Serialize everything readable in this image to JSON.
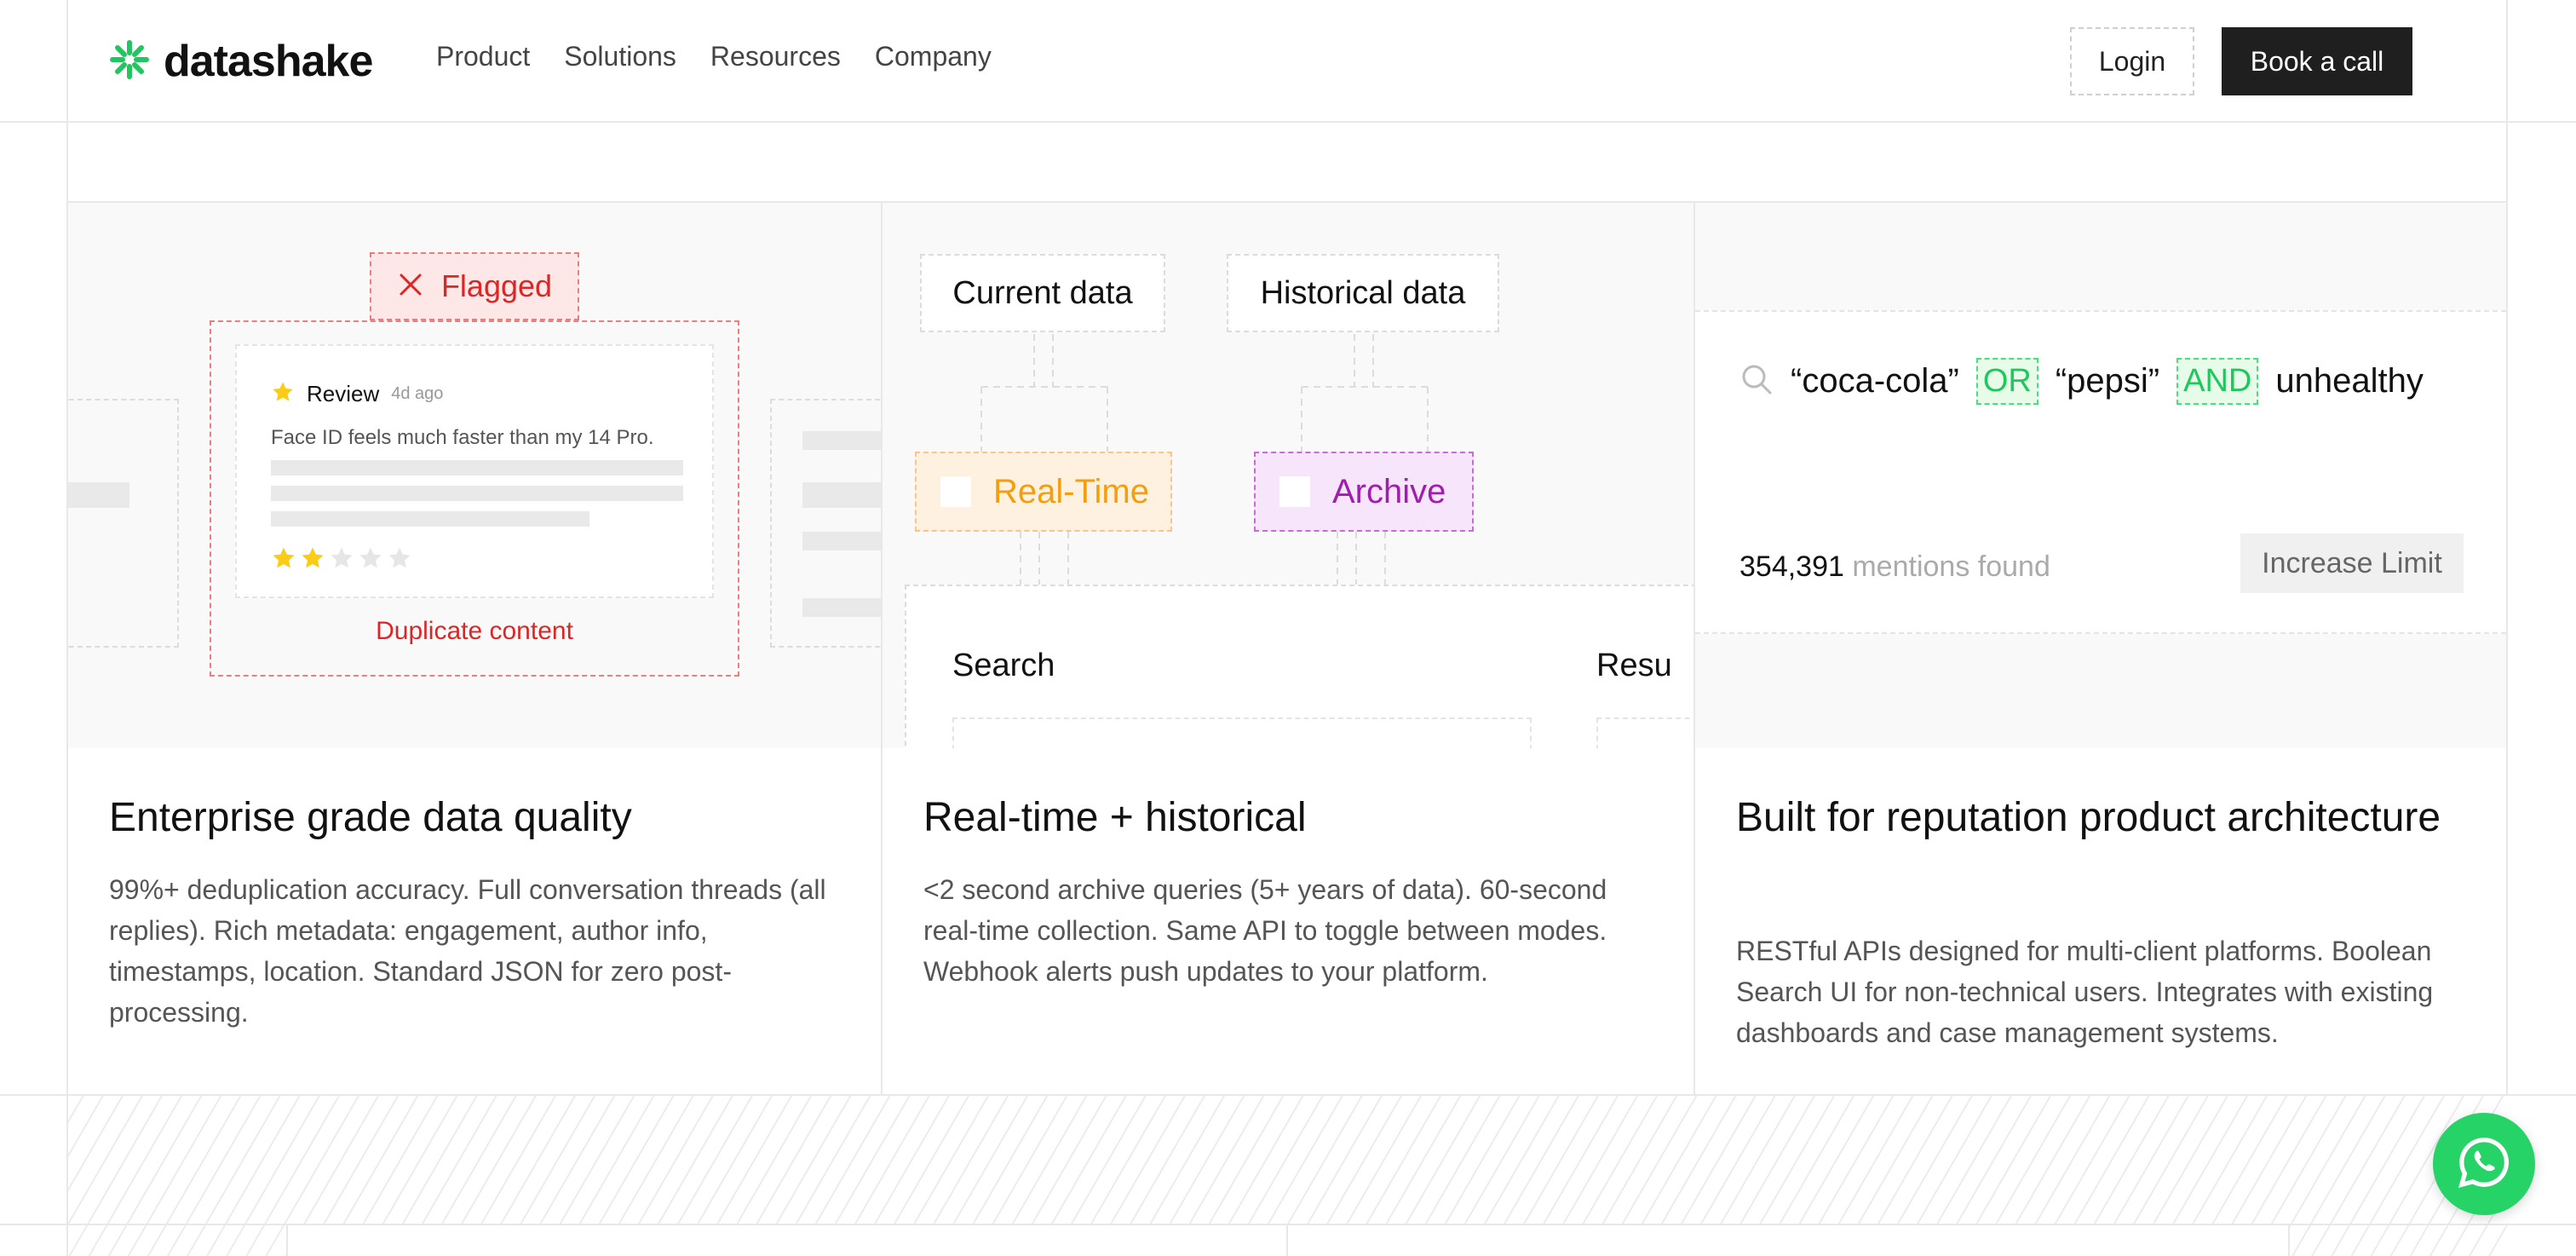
{
  "header": {
    "brand": "datashake",
    "nav": [
      "Product",
      "Solutions",
      "Resources",
      "Company"
    ],
    "login_label": "Login",
    "cta_label": "Book a call"
  },
  "cards": [
    {
      "title": "Enterprise grade data quality",
      "description": "99%+ deduplication accuracy. Full conversation threads (all replies). Rich metadata: engagement, author info, timestamps, location. Standard JSON for zero post-processing.",
      "illustration": {
        "flag_label": "Flagged",
        "review_label": "Review",
        "review_age": "4d ago",
        "review_text": "Face ID feels much faster than my 14 Pro.",
        "rating": 2,
        "rating_max": 5,
        "duplicate_label": "Duplicate content"
      }
    },
    {
      "title": "Real-time + historical",
      "description": "<2 second archive queries (5+ years of data). 60-second real-time collection. Same API to toggle between modes. Webhook alerts push updates to your platform.",
      "illustration": {
        "current_label": "Current data",
        "historical_label": "Historical data",
        "realtime_label": "Real-Time",
        "archive_label": "Archive",
        "search_label": "Search",
        "results_label": "Resu"
      }
    },
    {
      "title": "Built for reputation product architecture",
      "description": "RESTful APIs designed for multi-client platforms. Boolean Search UI for non-technical users. Integrates with existing dashboards and case management systems.",
      "illustration": {
        "query_terms": [
          "“coca-cola”",
          "OR",
          "“pepsi”",
          "AND",
          "unhealthy"
        ],
        "mentions_count": "354,391",
        "mentions_label": "mentions found",
        "increase_label": "Increase Limit"
      }
    }
  ],
  "colors": {
    "brand_green": "#22c55e",
    "flag_red": "#dc2626",
    "realtime_orange": "#f59e0b",
    "archive_purple": "#a21caf",
    "operator_green": "#22c55e",
    "whatsapp_green": "#25d366"
  },
  "icons": {
    "logo": "asterisk-burst-icon",
    "flag": "close-x-icon",
    "star": "star-icon",
    "search": "search-icon",
    "chat": "whatsapp-icon"
  }
}
